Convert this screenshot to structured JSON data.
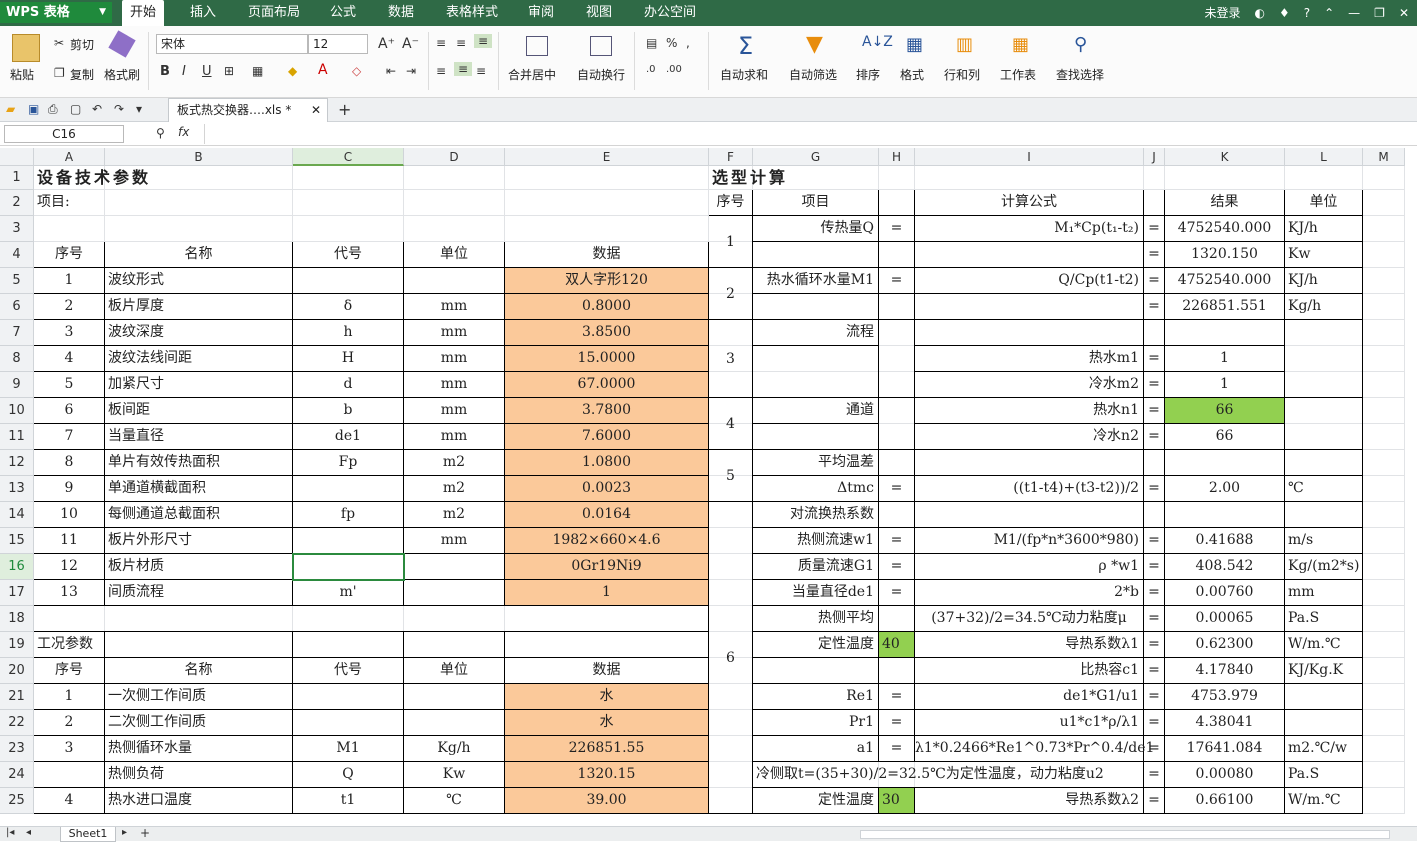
{
  "app": {
    "title": "WPS 表格",
    "menu": [
      "开始",
      "插入",
      "页面布局",
      "公式",
      "数据",
      "表格样式",
      "审阅",
      "视图",
      "办公空间"
    ],
    "login": "未登录"
  },
  "ribbon": {
    "paste": "粘贴",
    "cut": "剪切",
    "copy": "复制",
    "format_painter": "格式刷",
    "font_name": "宋体",
    "font_size": "12",
    "merge": "合并居中",
    "wrap": "自动换行",
    "autosum": "自动求和",
    "autofilter": "自动筛选",
    "sort": "排序",
    "format": "格式",
    "rowcol": "行和列",
    "worksheet": "工作表",
    "find": "查找选择"
  },
  "doc": {
    "tab": "板式热交换器….xls *"
  },
  "formula": {
    "cell_ref": "C16",
    "fx": "fx",
    "value": ""
  },
  "colors": {
    "accent": "#1f8a3c",
    "orange": "#fbc99a",
    "green": "#92d050"
  },
  "columns": [
    "A",
    "B",
    "C",
    "D",
    "E",
    "F",
    "G",
    "H",
    "I",
    "J",
    "K",
    "L",
    "M"
  ],
  "rows": [
    "1",
    "2",
    "3",
    "4",
    "5",
    "6",
    "7",
    "8",
    "9",
    "10",
    "11",
    "12",
    "13",
    "14",
    "15",
    "16",
    "17",
    "18",
    "19",
    "20",
    "21",
    "22",
    "23",
    "24",
    "25"
  ],
  "left": {
    "title": "设备技术参数",
    "project": "项目:",
    "headers": [
      "序号",
      "名称",
      "代号",
      "单位",
      "数据"
    ],
    "items": [
      [
        "1",
        "波纹形式",
        "",
        "",
        "双人字形120"
      ],
      [
        "2",
        "板片厚度",
        "δ",
        "mm",
        "0.8000"
      ],
      [
        "3",
        "波纹深度",
        "h",
        "mm",
        "3.8500"
      ],
      [
        "4",
        "波纹法线间距",
        "H",
        "mm",
        "15.0000"
      ],
      [
        "5",
        "加紧尺寸",
        "d",
        "mm",
        "67.0000"
      ],
      [
        "6",
        "板间距",
        "b",
        "mm",
        "3.7800"
      ],
      [
        "7",
        "当量直径",
        "de1",
        "mm",
        "7.6000"
      ],
      [
        "8",
        "单片有效传热面积",
        "Fp",
        "m2",
        "1.0800"
      ],
      [
        "9",
        "单通道横截面积",
        "",
        "m2",
        "0.0023"
      ],
      [
        "10",
        "每侧通道总截面积",
        "fp",
        "m2",
        "0.0164"
      ],
      [
        "11",
        "板片外形尺寸",
        "",
        "mm",
        "1982×660×4.6"
      ],
      [
        "12",
        "板片材质",
        "",
        "",
        "0Gr19Ni9"
      ],
      [
        "13",
        "间质流程",
        "m'",
        "",
        "1"
      ]
    ],
    "work_title": "工况参数",
    "work_headers": [
      "序号",
      "名称",
      "代号",
      "单位",
      "数据"
    ],
    "work_items": [
      [
        "1",
        "一次侧工作间质",
        "",
        "",
        "水"
      ],
      [
        "2",
        "二次侧工作间质",
        "",
        "",
        "水"
      ],
      [
        "3",
        "热侧循环水量",
        "M1",
        "Kg/h",
        "226851.55"
      ],
      [
        "",
        "热侧负荷",
        "Q",
        "Kw",
        "1320.15"
      ],
      [
        "4",
        "热水进口温度",
        "t1",
        "℃",
        "39.00"
      ]
    ]
  },
  "right": {
    "title": "选型计算",
    "headers": [
      "序号",
      "项目",
      "计算公式",
      "结果",
      "单位"
    ],
    "eq": "=",
    "s1": {
      "no": "1",
      "item": "传热量Q",
      "formula": "M₁*Cp(t₁-t₂)",
      "r1": "4752540.000",
      "u1": "KJ/h",
      "r2": "1320.150",
      "u2": "Kw"
    },
    "s2": {
      "no": "2",
      "item": "热水循环水量M1",
      "formula": "Q/Cp(t1-t2)",
      "r1": "4752540.000",
      "u1": "KJ/h",
      "r2": "226851.551",
      "u2": "Kg/h"
    },
    "s3": {
      "no": "3",
      "item": "流程",
      "f1": "热水m1",
      "r1": "1",
      "f2": "冷水m2",
      "r2": "1"
    },
    "s4": {
      "no": "4",
      "item": "通道",
      "f1": "热水n1",
      "r1": "66",
      "f2": "冷水n2",
      "r2": "66"
    },
    "s5": {
      "no": "5",
      "item": "平均温差",
      "item2": "Δtmc",
      "formula": "((t1-t4)+(t3-t2))/2",
      "r": "2.00",
      "u": "℃"
    },
    "s6": {
      "no": "6",
      "rows": [
        {
          "item": "对流换热系数",
          "formula": "",
          "r": "",
          "u": ""
        },
        {
          "item": "热侧流速w1",
          "formula": "M1/(fp*n*3600*980)",
          "r": "0.41688",
          "u": "m/s",
          "eq": true
        },
        {
          "item": "质量流速G1",
          "formula": "ρ *w1",
          "r": "408.542",
          "u": "Kg/(m2*s)",
          "eq": true
        },
        {
          "item": "当量直径de1",
          "formula": "2*b",
          "r": "0.00760",
          "u": "mm",
          "eq": true
        },
        {
          "item": "热侧平均",
          "formula": "(37+32)/2=34.5℃动力粘度μ",
          "r": "0.00065",
          "u": "Pa.S",
          "eq": true
        },
        {
          "item": "定性温度",
          "h": "40",
          "formula": "导热系数λ1",
          "r": "0.62300",
          "u": "W/m.℃",
          "eq": true
        },
        {
          "item": "",
          "formula": "比热容c1",
          "r": "4.17840",
          "u": "KJ/Kg.K",
          "eq": true
        },
        {
          "item": "Re1",
          "formula": "de1*G1/u1",
          "r": "4753.979",
          "u": "",
          "eq": true
        },
        {
          "item": "Pr1",
          "formula": "u1*c1*ρ/λ1",
          "r": "4.38041",
          "u": "",
          "eq": true
        },
        {
          "item": "a1",
          "formula": "λ1*0.2466*Re1^0.73*Pr^0.4/de1",
          "r": "17641.084",
          "u": "m2.℃/w",
          "eq": true
        },
        {
          "item": "冷侧取t=(35+30)/2=32.5℃为定性温度，动力粘度u2",
          "formula": "",
          "r": "0.00080",
          "u": "Pa.S",
          "eq": true
        },
        {
          "item": "定性温度",
          "h": "30",
          "formula": "导热系数λ2",
          "r": "0.66100",
          "u": "W/m.℃",
          "eq": true
        }
      ]
    }
  },
  "status": {
    "sheet": "Sheet1"
  }
}
